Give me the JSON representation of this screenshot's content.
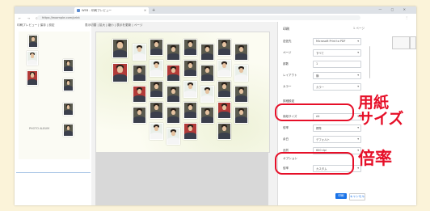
{
  "browser": {
    "tab_title": "WEB - 印刷プレビュー",
    "url": "https://example.com/print",
    "nav": "← → ⟳",
    "winctl": "— ▢ ✕",
    "menu": "⋮"
  },
  "doc": {
    "left_menu": "印刷プレビュー  |  保存  |  設定",
    "preview_menu": "表示切替  |  拡大  |  縮小  |  表示を更新  |  ページ",
    "caption": "PHOTO ALBUM"
  },
  "print_panel": {
    "title": "印刷",
    "page_count": "1 ページ",
    "rows": [
      {
        "label": "送信先",
        "value": "Microsoft Print to PDF"
      },
      {
        "label": "ページ",
        "value": "すべて"
      },
      {
        "label": "部数",
        "value": "1"
      },
      {
        "label": "レイアウト",
        "value": "横"
      },
      {
        "label": "カラー",
        "value": "カラー"
      }
    ],
    "details": "詳細設定",
    "paper_row": {
      "label": "用紙サイズ",
      "value": "A4"
    },
    "mid_rows": [
      {
        "label": "倍率",
        "value": "標準"
      },
      {
        "label": "余白",
        "value": "デフォルト"
      },
      {
        "label": "品質",
        "value": "600 dpi"
      }
    ],
    "options": "オプション",
    "scale_row": {
      "label": "倍率",
      "value": "カスタム"
    },
    "print_button": "印刷",
    "cancel_button": "キャンセル"
  },
  "annotations": {
    "paper_size_lines": [
      "用紙",
      "サイズ"
    ],
    "scale": "倍率",
    "color": "#e60f28"
  }
}
